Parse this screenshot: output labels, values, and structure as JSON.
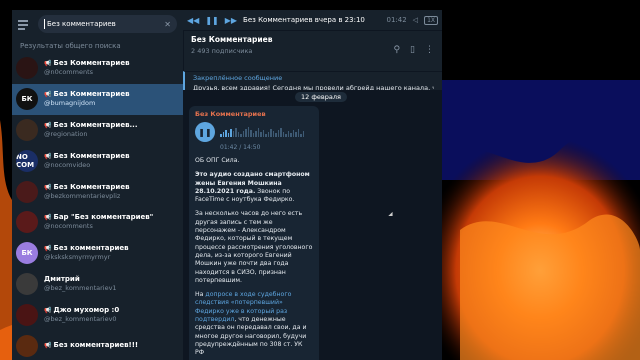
{
  "search": {
    "value": "Без комментариев",
    "section_label": "Результаты общего поиска"
  },
  "results": [
    {
      "name": "Без Комментариев",
      "user": "@n0comments",
      "icon": "megaphone-icon",
      "avatar_text": "",
      "avatar_color": "#2a1414",
      "active": false
    },
    {
      "name": "Без Комментариев",
      "user": "@bumagnijdom",
      "icon": "megaphone-icon",
      "avatar_text": "БК",
      "avatar_color": "#111111",
      "active": true
    },
    {
      "name": "Без Комментариев...",
      "user": "@regionation",
      "icon": "megaphone-icon",
      "avatar_text": "",
      "avatar_color": "#3a2a20",
      "active": false
    },
    {
      "name": "Без Комментариев",
      "user": "@nocomvideo",
      "icon": "megaphone-icon",
      "avatar_text": "NO COM",
      "avatar_color": "#1a2e66",
      "active": false
    },
    {
      "name": "Без Комментариев",
      "user": "@bezkommentarievpliz",
      "icon": "megaphone-icon",
      "avatar_text": "",
      "avatar_color": "#4a1a1a",
      "active": false
    },
    {
      "name": "Бар \"Без комментариев\"",
      "user": "@nocomments",
      "icon": "megaphone-icon",
      "avatar_text": "",
      "avatar_color": "#5a1a1a",
      "active": false
    },
    {
      "name": "Без комментариев",
      "user": "@ksksksmyrmyrmyr",
      "icon": "megaphone-icon",
      "avatar_text": "БК",
      "avatar_color": "#9a7de0",
      "active": false
    },
    {
      "name": "Дмитрий",
      "user": "@bez_kommentariev1",
      "icon": "",
      "avatar_text": "",
      "avatar_color": "#3a3a3a",
      "active": false
    },
    {
      "name": "Джо мухомор :0",
      "user": "@bez_kommentariev0",
      "icon": "megaphone-icon",
      "avatar_text": "",
      "avatar_color": "#4a1414",
      "active": false
    },
    {
      "name": "Без комментариев!!!",
      "user": "",
      "icon": "megaphone-icon",
      "avatar_text": "",
      "avatar_color": "#5a2a10",
      "active": false
    }
  ],
  "player": {
    "title": "Без Комментариев вчера в 23:10",
    "time": "01:42",
    "speed": "1X"
  },
  "channel": {
    "name": "Без Комментариев",
    "subscribers": "2 493 подписчика"
  },
  "pinned": {
    "title": "Закреплённое сообщение",
    "text": "Друзья, всем здравия! Сегодня мы провели абгрейд нашего канала, чтоб"
  },
  "chat": {
    "date": "12 февраля"
  },
  "message": {
    "author": "Без Комментариев",
    "audio_time": "01:42 / 14:50",
    "audio_progress": 0.12,
    "p1": "ОБ ОПГ Сила.",
    "p2_bold": "Это аудио создано смартфоном жены Евгения Мошкина 28.10.2021 года.",
    "p2_rest": " Звонок по FaceTime с ноутбука Федирко.",
    "p3": "За несколько часов до него есть другая запись с тем же персонажем - Александром Федирко, который в текущем процессе рассмотрения уголовного дела, из-за которого Евгений Мошкин уже почти два года находится в СИЗО, признан потерпевшим.",
    "p4_pre": "На ",
    "p4_link": "допросе в ходе судебного следствия «потерпевший» Федирко уже в который раз подтвердил",
    "p4_post": ", что денежные средства он передавал свои, да и многое другое наговорил, будучи предупреждённым по 308 ст. УК РФ"
  },
  "colors": {
    "accent": "#5ea6e0",
    "active_row": "#2b5278",
    "author": "#e6724e"
  }
}
